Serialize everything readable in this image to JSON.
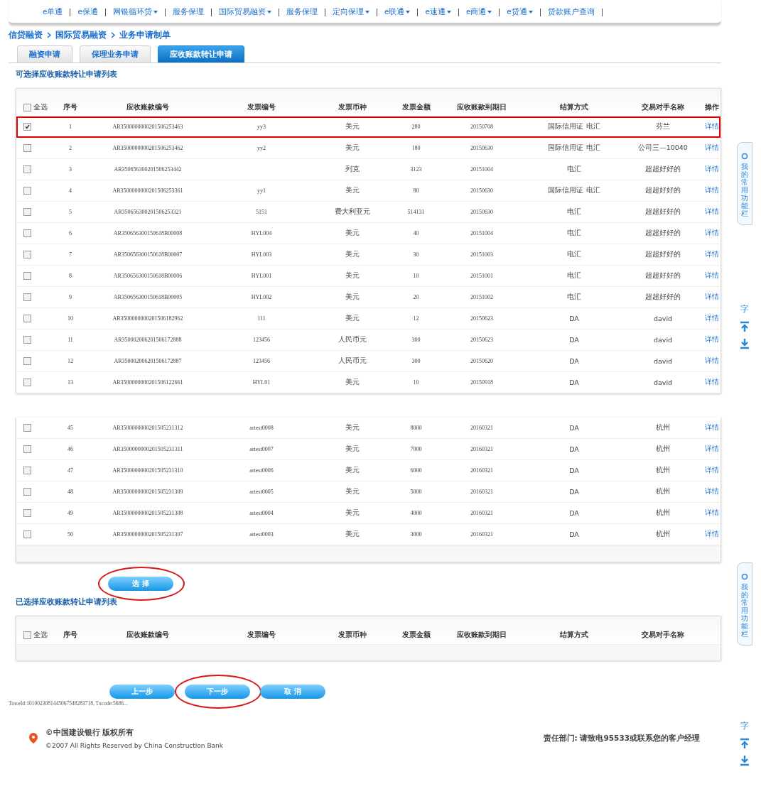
{
  "nav": [
    {
      "label": "e单通",
      "dropdown": false
    },
    {
      "label": "e保通",
      "dropdown": false
    },
    {
      "label": "网银循环贷",
      "dropdown": true
    },
    {
      "label": "服务保理",
      "dropdown": false
    },
    {
      "label": "国际贸易融资",
      "dropdown": true
    },
    {
      "label": "服务保理",
      "dropdown": false
    },
    {
      "label": "定向保理",
      "dropdown": true
    },
    {
      "label": "e联通",
      "dropdown": true
    },
    {
      "label": "e速通",
      "dropdown": true
    },
    {
      "label": "e商通",
      "dropdown": true
    },
    {
      "label": "e贷通",
      "dropdown": true
    },
    {
      "label": "贷款账户查询",
      "dropdown": false
    }
  ],
  "breadcrumb": [
    "信贷融资",
    "国际贸易融资",
    "业务申请制单"
  ],
  "tabs": [
    {
      "label": "融资申请",
      "selected": false
    },
    {
      "label": "保理业务申请",
      "selected": false
    },
    {
      "label": "应收账款转让申请",
      "selected": true
    }
  ],
  "available_list": {
    "title": "可选择应收账款转让申请列表",
    "select_all": {
      "label": "全选",
      "checked": false
    },
    "columns": [
      "序号",
      "应收账款编号",
      "发票编号",
      "发票币种",
      "发票金额",
      "应收账款到期日",
      "结算方式",
      "交易对手名称",
      "操作"
    ],
    "rows": [
      {
        "checked": true,
        "highlighted": true,
        "cells": {
          "seq": "1",
          "ar_no": "AR3500000000201506253463",
          "invoice_no": "yy3",
          "currency": "美元",
          "amount": "280",
          "due_date": "20150708",
          "settlement": "国际信用证 电汇",
          "counterparty": "芬兰",
          "action": "详情"
        }
      },
      {
        "checked": false,
        "highlighted": false,
        "cells": {
          "seq": "2",
          "ar_no": "AR3500000000201506253462",
          "invoice_no": "yy2",
          "currency": "美元",
          "amount": "180",
          "due_date": "20150630",
          "settlement": "国际信用证 电汇",
          "counterparty": "公司三—10040",
          "action": "详情"
        }
      },
      {
        "checked": false,
        "highlighted": false,
        "cells": {
          "seq": "3",
          "ar_no": "AR350656300201506253442",
          "currency": "列克",
          "amount": "3123",
          "due_date": "20151004",
          "settlement": "电汇",
          "counterparty": "超超好好的",
          "action": "详情"
        }
      },
      {
        "checked": false,
        "highlighted": false,
        "cells": {
          "seq": "4",
          "ar_no": "AR3500000000201506253361",
          "invoice_no": "yy1",
          "currency": "美元",
          "amount": "80",
          "due_date": "20150630",
          "settlement": "国际信用证 电汇",
          "counterparty": "超超好好的",
          "action": "详情"
        }
      },
      {
        "checked": false,
        "highlighted": false,
        "cells": {
          "seq": "5",
          "ar_no": "AR350656300201506253321",
          "invoice_no": "5151",
          "currency": "费大利亚元",
          "amount": "514131",
          "due_date": "20150630",
          "settlement": "电汇",
          "counterparty": "超超好好的",
          "action": "详情"
        }
      },
      {
        "checked": false,
        "highlighted": false,
        "cells": {
          "seq": "6",
          "ar_no": "AR350656300150618B00008",
          "invoice_no": "HYL004",
          "currency": "美元",
          "amount": "40",
          "due_date": "20151004",
          "settlement": "电汇",
          "counterparty": "超超好好的",
          "action": "详情"
        }
      },
      {
        "checked": false,
        "highlighted": false,
        "cells": {
          "seq": "7",
          "ar_no": "AR350656300150618B00007",
          "invoice_no": "HYL003",
          "currency": "美元",
          "amount": "30",
          "due_date": "20151003",
          "settlement": "电汇",
          "counterparty": "超超好好的",
          "action": "详情"
        }
      },
      {
        "checked": false,
        "highlighted": false,
        "cells": {
          "seq": "8",
          "ar_no": "AR350656300150618B00006",
          "invoice_no": "HYL001",
          "currency": "美元",
          "amount": "10",
          "due_date": "20151001",
          "settlement": "电汇",
          "counterparty": "超超好好的",
          "action": "详情"
        }
      },
      {
        "checked": false,
        "highlighted": false,
        "cells": {
          "seq": "9",
          "ar_no": "AR350656300150618B00005",
          "invoice_no": "HYL002",
          "currency": "美元",
          "amount": "20",
          "due_date": "20151002",
          "settlement": "电汇",
          "counterparty": "超超好好的",
          "action": "详情"
        }
      },
      {
        "checked": false,
        "highlighted": false,
        "cells": {
          "seq": "10",
          "ar_no": "AR3500000000201506182962",
          "invoice_no": "111",
          "currency": "美元",
          "amount": "12",
          "due_date": "20150623",
          "settlement": "DA",
          "counterparty": "david",
          "action": "详情"
        }
      },
      {
        "checked": false,
        "highlighted": false,
        "cells": {
          "seq": "11",
          "ar_no": "AR350002006201506172888",
          "invoice_no": "123456",
          "currency": "人民币元",
          "amount": "300",
          "due_date": "20150623",
          "settlement": "DA",
          "counterparty": "david",
          "action": "详情"
        }
      },
      {
        "checked": false,
        "highlighted": false,
        "cells": {
          "seq": "12",
          "ar_no": "AR350002006201506172887",
          "invoice_no": "123456",
          "currency": "人民币元",
          "amount": "300",
          "due_date": "20150620",
          "settlement": "DA",
          "counterparty": "david",
          "action": "详情"
        }
      },
      {
        "checked": false,
        "highlighted": false,
        "cells": {
          "seq": "13",
          "ar_no": "AR3500000000201506122661",
          "invoice_no": "HYL01",
          "currency": "美元",
          "amount": "10",
          "due_date": "20150918",
          "settlement": "DA",
          "counterparty": "david",
          "action": "详情"
        }
      }
    ],
    "rows_lower": [
      {
        "checked": false,
        "highlighted": false,
        "cells": {
          "seq": "45",
          "ar_no": "AR3500000000201505231312",
          "invoice_no": "artest0008",
          "currency": "美元",
          "amount": "8000",
          "due_date": "20160321",
          "settlement": "DA",
          "counterparty": "杭州",
          "action": "详情"
        }
      },
      {
        "checked": false,
        "highlighted": false,
        "cells": {
          "seq": "46",
          "ar_no": "AR3500000000201505231311",
          "invoice_no": "artest0007",
          "currency": "美元",
          "amount": "7000",
          "due_date": "20160321",
          "settlement": "DA",
          "counterparty": "杭州",
          "action": "详情"
        }
      },
      {
        "checked": false,
        "highlighted": false,
        "cells": {
          "seq": "47",
          "ar_no": "AR3500000000201505231310",
          "invoice_no": "artest0006",
          "currency": "美元",
          "amount": "6000",
          "due_date": "20160321",
          "settlement": "DA",
          "counterparty": "杭州",
          "action": "详情"
        }
      },
      {
        "checked": false,
        "highlighted": false,
        "cells": {
          "seq": "48",
          "ar_no": "AR3500000000201505231309",
          "invoice_no": "artest0005",
          "currency": "美元",
          "amount": "5000",
          "due_date": "20160321",
          "settlement": "DA",
          "counterparty": "杭州",
          "action": "详情"
        }
      },
      {
        "checked": false,
        "highlighted": false,
        "cells": {
          "seq": "49",
          "ar_no": "AR3500000000201505231308",
          "invoice_no": "artest0004",
          "currency": "美元",
          "amount": "4000",
          "due_date": "20160321",
          "settlement": "DA",
          "counterparty": "杭州",
          "action": "详情"
        }
      },
      {
        "checked": false,
        "highlighted": false,
        "cells": {
          "seq": "50",
          "ar_no": "AR3500000000201505231307",
          "invoice_no": "artest0003",
          "currency": "美元",
          "amount": "3000",
          "due_date": "20160321",
          "settlement": "DA",
          "counterparty": "杭州",
          "action": "详情"
        }
      }
    ]
  },
  "select_button": {
    "label": "选 择",
    "circled": true
  },
  "selected_list": {
    "title": "已选择应收账款转让申请列表",
    "select_all": {
      "label": "全选",
      "checked": false
    },
    "columns": [
      "序号",
      "应收账款编号",
      "发票编号",
      "发票币种",
      "发票金额",
      "应收账款到期日",
      "结算方式",
      "交易对手名称"
    ]
  },
  "actions": [
    {
      "label": "上一步",
      "circled": false
    },
    {
      "label": "下一步",
      "circled": true
    },
    {
      "label": "取 消",
      "circled": false
    }
  ],
  "trace": "TraceId:1010023081445067548283718, Txcode:5686...",
  "footer": {
    "brand": "©中国建设银行 版权所有",
    "copyright": "©2007 All Rights Reserved by China Construction Bank",
    "contact": "责任部门: 请致电95533或联系您的客户经理"
  },
  "side_rail": [
    {
      "tab": "我的常用功能栏",
      "font_key": "字"
    },
    {
      "tab": "我的常用功能栏",
      "font_key": "字"
    }
  ]
}
